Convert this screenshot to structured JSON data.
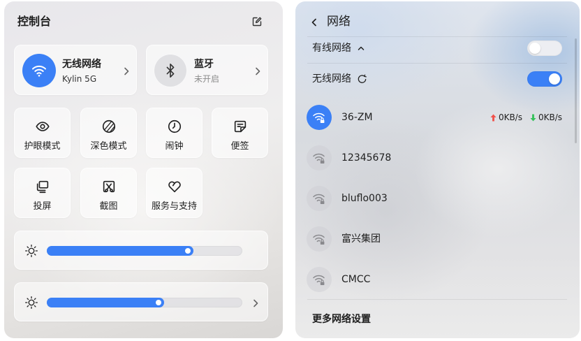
{
  "control_center": {
    "title": "控制台",
    "edit_icon": "edit-icon",
    "wifi_card": {
      "title": "无线网络",
      "subtitle": "Kylin 5G",
      "icon": "wifi-icon",
      "enabled": true
    },
    "bluetooth_card": {
      "title": "蓝牙",
      "subtitle": "未开启",
      "icon": "bluetooth-icon",
      "enabled": false
    },
    "tiles": [
      {
        "label": "护眼模式",
        "icon": "eye-icon"
      },
      {
        "label": "深色模式",
        "icon": "dark-mode-icon"
      },
      {
        "label": "闹钟",
        "icon": "alarm-clock-icon"
      },
      {
        "label": "便签",
        "icon": "sticky-note-icon"
      },
      {
        "label": "投屏",
        "icon": "screen-projection-icon"
      },
      {
        "label": "截图",
        "icon": "screenshot-icon"
      },
      {
        "label": "服务与支持",
        "icon": "service-support-icon"
      }
    ],
    "sliders": [
      {
        "icon": "brightness-icon",
        "level": 0.75,
        "has_chevron": false
      },
      {
        "icon": "brightness-icon",
        "level": 0.6,
        "has_chevron": true
      }
    ]
  },
  "network": {
    "title": "网络",
    "back_icon": "chevron-left-icon",
    "wired": {
      "label": "有线网络",
      "expanded": true,
      "enabled": false,
      "icon": "chevron-up-icon"
    },
    "wireless": {
      "label": "无线网络",
      "enabled": true,
      "icon": "refresh-icon"
    },
    "networks": [
      {
        "ssid": "36-ZM",
        "connected": true,
        "secured": true,
        "upload": "0KB/s",
        "download": "0KB/s"
      },
      {
        "ssid": "12345678",
        "connected": false,
        "secured": true
      },
      {
        "ssid": "bluflo003",
        "connected": false,
        "secured": true
      },
      {
        "ssid": "富兴集团",
        "connected": false,
        "secured": true
      },
      {
        "ssid": "CMCC",
        "connected": false,
        "secured": true
      }
    ],
    "more_settings_label": "更多网络设置"
  },
  "colors": {
    "accent": "#3b80f6",
    "upload_arrow": "#f0524b",
    "download_arrow": "#35c15a",
    "text_primary": "#1f1f1f",
    "text_secondary": "#8c8c8c"
  }
}
